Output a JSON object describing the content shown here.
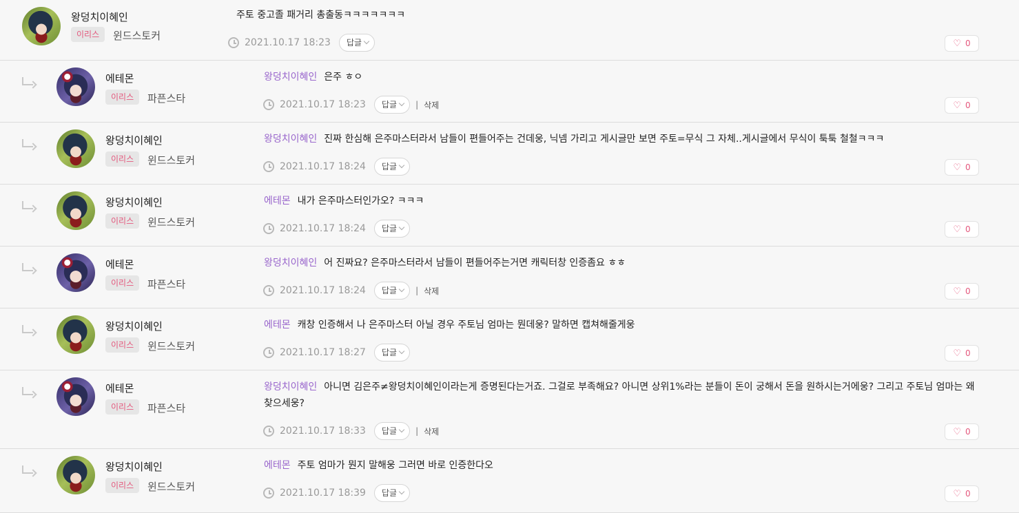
{
  "comments": [
    {
      "author": "왕덩치이혜인",
      "badge": "이리스",
      "world": "윈드스토커",
      "mention": "",
      "text": "주토 중고졸 패거리 총출동ㅋㅋㅋㅋㅋㅋㅋ",
      "date": "2021.10.17 18:23",
      "reply_label": "답글",
      "delete_label": "",
      "likes": "0"
    },
    {
      "author": "에테몬",
      "badge": "이리스",
      "world": "파픈스타",
      "mention": "왕덩치이혜인",
      "text": "은주 ㅎㅇ",
      "date": "2021.10.17 18:23",
      "reply_label": "답글",
      "delete_label": "삭제",
      "likes": "0"
    },
    {
      "author": "왕덩치이혜인",
      "badge": "이리스",
      "world": "윈드스토커",
      "mention": "왕덩치이혜인",
      "text": "진짜 한심해 은주마스터라서 남들이 편들어주는 건데웅, 닉넴 가리고 게시글만 보면 주토=무식 그 자체..게시글에서 무식이 툭툭 철철ㅋㅋㅋ",
      "date": "2021.10.17 18:24",
      "reply_label": "답글",
      "delete_label": "",
      "likes": "0"
    },
    {
      "author": "왕덩치이혜인",
      "badge": "이리스",
      "world": "윈드스토커",
      "mention": "에테몬",
      "text": "내가 은주마스터인가오? ㅋㅋㅋ",
      "date": "2021.10.17 18:24",
      "reply_label": "답글",
      "delete_label": "",
      "likes": "0"
    },
    {
      "author": "에테몬",
      "badge": "이리스",
      "world": "파픈스타",
      "mention": "왕덩치이혜인",
      "text": "어 진짜요? 은주마스터라서 남들이 편들어주는거면 캐릭터창 인증좀요 ㅎㅎ",
      "date": "2021.10.17 18:24",
      "reply_label": "답글",
      "delete_label": "삭제",
      "likes": "0"
    },
    {
      "author": "왕덩치이혜인",
      "badge": "이리스",
      "world": "윈드스토커",
      "mention": "에테몬",
      "text": "캐창 인증해서 나 은주마스터 아닐 경우 주토님 엄마는 뭔데웅? 말하면 캡쳐해줄게웅",
      "date": "2021.10.17 18:27",
      "reply_label": "답글",
      "delete_label": "",
      "likes": "0"
    },
    {
      "author": "에테몬",
      "badge": "이리스",
      "world": "파픈스타",
      "mention": "왕덩치이혜인",
      "text": "아니면 김은주≠왕덩치이혜인이라는게 증명된다는거죠. 그걸로 부족해요? 아니면 상위1%라는 분들이 돈이 궁해서 돈을 원하시는거에웅? 그리고 주토님 엄마는 왜 찾으세웅?",
      "date": "2021.10.17 18:33",
      "reply_label": "답글",
      "delete_label": "삭제",
      "likes": "0"
    },
    {
      "author": "왕덩치이혜인",
      "badge": "이리스",
      "world": "윈드스토커",
      "mention": "에테몬",
      "text": "주토 엄마가 뭔지 말해웅 그러면 바로 인증한다오",
      "date": "2021.10.17 18:39",
      "reply_label": "답글",
      "delete_label": "",
      "likes": "0"
    }
  ]
}
